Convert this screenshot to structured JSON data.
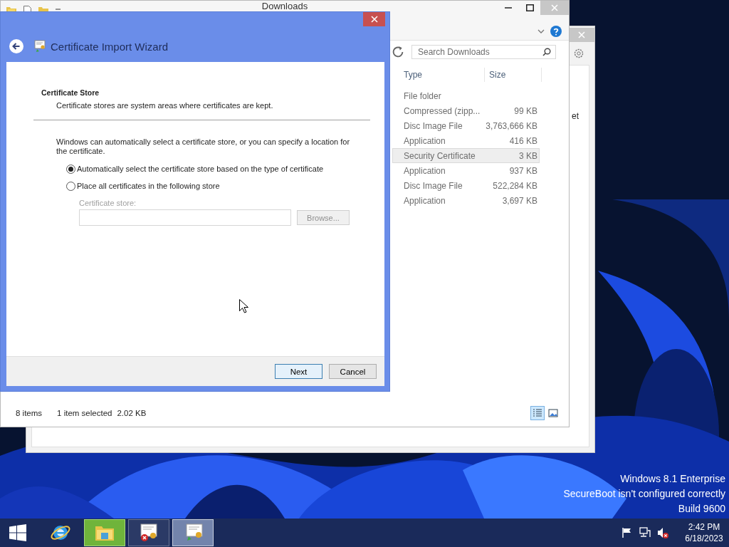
{
  "desktop": {
    "kind": "picture",
    "notice_lines": [
      "Windows 8.1 Enterprise",
      "SecureBoot isn't configured correctly",
      "Build 9600"
    ]
  },
  "back_window": {
    "text_fragment": "et"
  },
  "explorer": {
    "title": "Downloads",
    "search": {
      "placeholder": "Search Downloads"
    },
    "columns": [
      "Type",
      "Size"
    ],
    "rows": [
      {
        "type": "File folder",
        "selected": false
      },
      {
        "type": "Compressed (zipp...",
        "size": "99 KB",
        "selected": false
      },
      {
        "type": "Disc Image File",
        "size": "3,763,666 KB",
        "selected": false
      },
      {
        "type": "Application",
        "size": "416 KB",
        "selected": false
      },
      {
        "type": "Security Certificate",
        "size": "3 KB",
        "selected": true
      },
      {
        "type": "Application",
        "size": "937 KB",
        "selected": false
      },
      {
        "type": "Disc Image File",
        "size": "522,284 KB",
        "selected": false
      },
      {
        "type": "Application",
        "size": "3,697 KB",
        "selected": false
      }
    ],
    "status_bar": {
      "item_count": "8 items",
      "selection": "1 item selected",
      "selection_size": "2.02 KB",
      "views": [
        {
          "kind": "details",
          "selected": true
        },
        {
          "kind": "large_icons",
          "selected": false
        }
      ]
    }
  },
  "wizard": {
    "title": "Certificate Import Wizard",
    "heading": "Certificate Store",
    "subheading": "Certificate stores are system areas where certificates are kept.",
    "intro": "Windows can automatically select a certificate store, or you can specify a location for the certificate.",
    "options": [
      {
        "label": "Automatically select the certificate store based on the type of certificate",
        "selected": true
      },
      {
        "label": "Place all certificates in the following store",
        "selected": false
      }
    ],
    "store_field": {
      "label": "Certificate store:",
      "disabled": true
    },
    "browse_button": {
      "label": "Browse...",
      "disabled": true
    },
    "buttons": [
      {
        "label": "Next",
        "default": true
      },
      {
        "label": "Cancel",
        "default": false
      }
    ]
  },
  "taskbar": {
    "apps": [
      {
        "kind": "browser",
        "running": false,
        "hovered": false,
        "selected": false
      },
      {
        "kind": "folder",
        "running": true,
        "hovered": true,
        "selected": false
      },
      {
        "kind": "certificate_error",
        "running": true,
        "hovered": false,
        "selected": false
      },
      {
        "kind": "certificate_import",
        "running": true,
        "hovered": false,
        "selected": true
      }
    ],
    "tray": [
      {
        "kind": "flag"
      },
      {
        "kind": "network"
      },
      {
        "kind": "volume_muted"
      }
    ],
    "clock": {
      "time": "2:42 PM",
      "date": "6/18/2023"
    }
  }
}
